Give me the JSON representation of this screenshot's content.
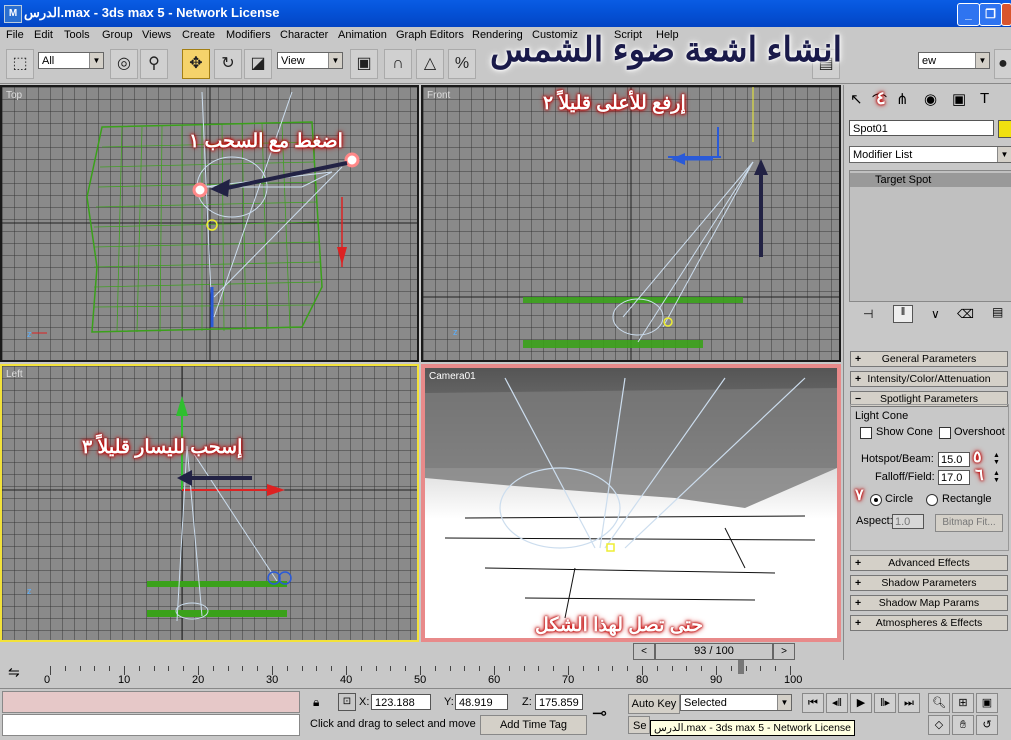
{
  "window": {
    "title": "الدرس.max - 3ds max 5 - Network License",
    "app_icon": "3ds-max-icon",
    "minimize": "_",
    "maximize": "❐",
    "close": "✕"
  },
  "menu": [
    "File",
    "Edit",
    "Tools",
    "Group",
    "Views",
    "Create",
    "Modifiers",
    "Character",
    "Animation",
    "Graph Editors",
    "Rendering",
    "Customiz",
    "Script",
    "Help"
  ],
  "toolbar": {
    "selection_filter": "All",
    "reference_coord": "View",
    "right_dropdown": "ew"
  },
  "banner_title": "انشاء اشعة ضوء الشمس",
  "viewports": {
    "top": {
      "label": "Top",
      "callout_num": "١",
      "callout": "اضغط مع السحب"
    },
    "front": {
      "label": "Front",
      "callout_num": "٢",
      "callout": "إرفع للأعلى قليلاً"
    },
    "left": {
      "label": "Left",
      "callout_num": "٣",
      "callout": "إسحب لليسار قليلاً"
    },
    "camera": {
      "label": "Camera01",
      "callout": "حتى تصل لهذا الشكل"
    }
  },
  "panel": {
    "object_name": "Spot01",
    "modifier_list": "Modifier List",
    "stack_item": "Target Spot",
    "step4": "٤",
    "rollouts_top": [
      {
        "pm": "+",
        "label": "General Parameters"
      },
      {
        "pm": "+",
        "label": "Intensity/Color/Attenuation"
      },
      {
        "pm": "−",
        "label": "Spotlight Parameters"
      }
    ],
    "light_cone": "Light Cone",
    "show_cone": "Show Cone",
    "overshoot": "Overshoot",
    "hotspot_label": "Hotspot/Beam:",
    "hotspot_value": "15.0",
    "hotspot_step": "٥",
    "falloff_label": "Falloff/Field:",
    "falloff_value": "17.0",
    "falloff_step": "٦",
    "circle_step": "٧",
    "circle": "Circle",
    "rectangle": "Rectangle",
    "aspect_label": "Aspect:",
    "aspect_value": "1.0",
    "bitmap_fit": "Bitmap Fit...",
    "rollouts_bottom": [
      {
        "pm": "+",
        "label": "Advanced Effects"
      },
      {
        "pm": "+",
        "label": "Shadow Parameters"
      },
      {
        "pm": "+",
        "label": "Shadow Map Params"
      },
      {
        "pm": "+",
        "label": "Atmospheres & Effects"
      }
    ]
  },
  "timeline": {
    "frame_display": "93 / 100",
    "current_frame_fraction": 0.93,
    "ticks": [
      "0",
      "10",
      "20",
      "30",
      "40",
      "50",
      "60",
      "70",
      "80",
      "90",
      "100"
    ]
  },
  "status": {
    "x_label": "X:",
    "x_value": "123.188",
    "y_label": "Y:",
    "y_value": "48.919",
    "z_label": "Z:",
    "z_value": "175.859",
    "prompt": "Click and drag to select and move",
    "add_time_tag": "Add Time Tag",
    "auto_key": "Auto Key",
    "selected": "Selected",
    "set_key": "Se",
    "tooltip": "الدرس.max - 3ds max 5 - Network License"
  },
  "colors": {
    "active_viewport": "#f3e23a",
    "camera_border": "#e88a8a",
    "callout_glow": "#cc0000",
    "mesh_green": "#3a8a1a"
  }
}
